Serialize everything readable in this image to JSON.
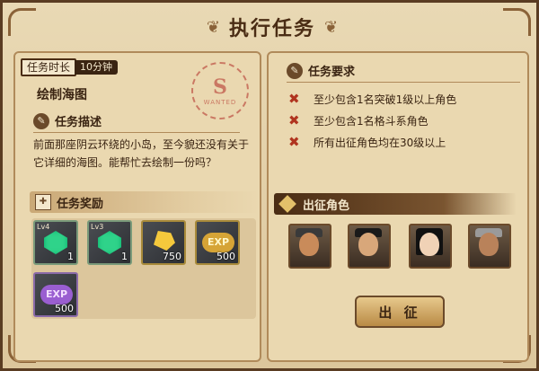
{
  "window": {
    "title": "执行任务"
  },
  "mission": {
    "time_label": "任务时长",
    "time_value": "10分钟",
    "name": "绘制海图",
    "stamp_letter": "S",
    "stamp_text": "WANTED",
    "description_heading": "任务描述",
    "description": "前面那座阴云环绕的小岛，至今貌还没有关于它详细的海图。能帮忙去绘制一份吗？"
  },
  "rewards": {
    "heading": "任务奖励",
    "items": [
      {
        "level": "Lv4",
        "count": "1",
        "icon": "green-gem-icon"
      },
      {
        "level": "Lv3",
        "count": "1",
        "icon": "green-gem-icon"
      },
      {
        "level": "",
        "count": "750",
        "icon": "gold-nugget-icon"
      },
      {
        "level": "",
        "count": "500",
        "icon": "exp-gold-icon",
        "label": "EXP"
      },
      {
        "level": "",
        "count": "500",
        "icon": "exp-purple-icon",
        "label": "EXP"
      }
    ]
  },
  "requirements": {
    "heading": "任务要求",
    "items": [
      "至少包含1名突破1级以上角色",
      "至少包含1名格斗系角色",
      "所有出征角色均在30级以上"
    ]
  },
  "heroes": {
    "heading": "出征角色",
    "slots": [
      "hero-1",
      "hero-2",
      "hero-3",
      "hero-4"
    ]
  },
  "deploy_button": "出 征",
  "colors": {
    "accent": "#4a2c14",
    "parchment": "#ead8b0",
    "cross": "#b0341f"
  }
}
